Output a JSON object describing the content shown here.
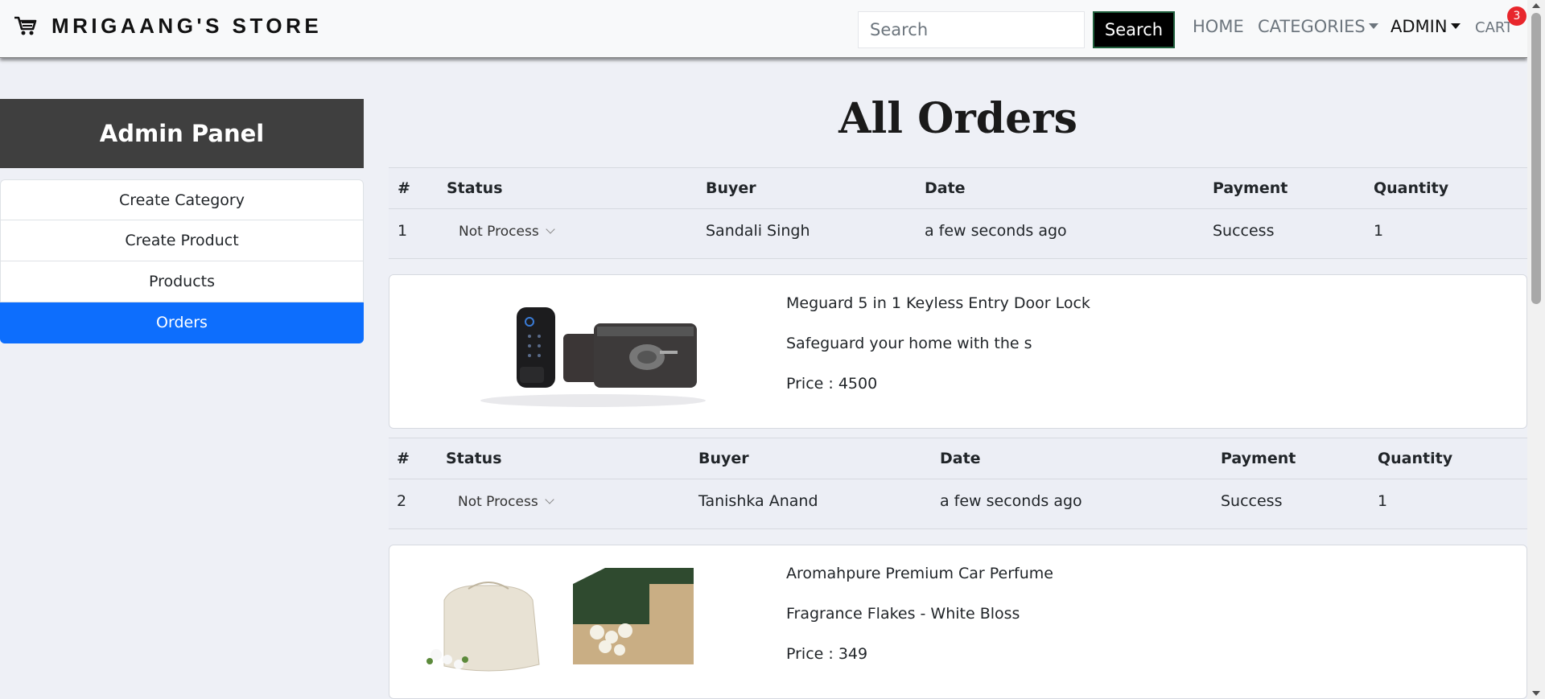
{
  "navbar": {
    "brand": "MRIGAANG'S STORE",
    "search_placeholder": "Search",
    "search_button": "Search",
    "home": "HOME",
    "categories": "CATEGORIES",
    "admin": "ADMIN",
    "cart": "CART",
    "cart_count": "3"
  },
  "sidebar": {
    "title": "Admin Panel",
    "items": [
      {
        "label": "Create Category"
      },
      {
        "label": "Create Product"
      },
      {
        "label": "Products"
      },
      {
        "label": "Orders"
      }
    ]
  },
  "main": {
    "title": "All Orders",
    "columns": [
      "#",
      "Status",
      "Buyer",
      "Date",
      "Payment",
      "Quantity"
    ],
    "orders": [
      {
        "index": "1",
        "status": "Not Process",
        "buyer": "Sandali Singh",
        "date": "a few seconds ago",
        "payment": "Success",
        "quantity": "1",
        "product": {
          "name": "Meguard 5 in 1 Keyless Entry Door Lock",
          "description": "Safeguard your home with the s",
          "price": "Price : 4500"
        }
      },
      {
        "index": "2",
        "status": "Not Process",
        "buyer": "Tanishka Anand",
        "date": "a few seconds ago",
        "payment": "Success",
        "quantity": "1",
        "product": {
          "name": "Aromahpure Premium Car Perfume",
          "description": "Fragrance Flakes - White Bloss",
          "price": "Price : 349"
        }
      }
    ]
  },
  "colors": {
    "accent": "#0d6efd",
    "panel_header": "#3f3f3f",
    "badge": "#e8262c"
  }
}
